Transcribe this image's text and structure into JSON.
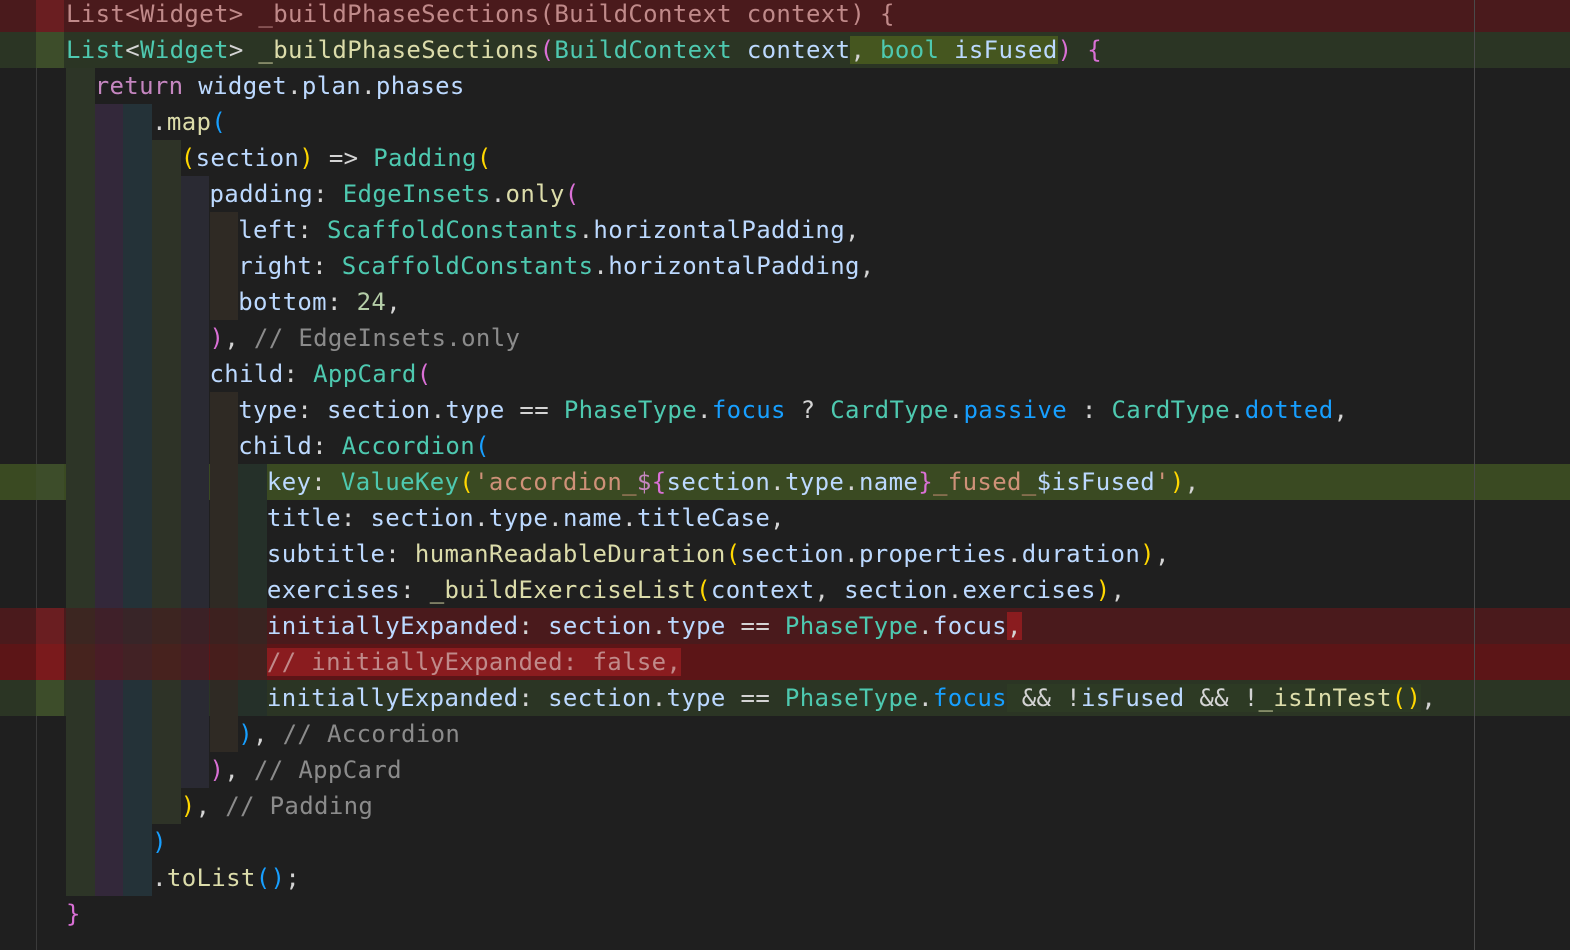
{
  "editor": {
    "language": "dart",
    "colors": {
      "background": "#1f1f1f",
      "added_line": "#2b3524",
      "removed_line": "#4a1a1c",
      "keyword": "#c586c0",
      "type": "#4ec9b0",
      "function": "#dcdcaa",
      "variable": "#bcd9ff",
      "string": "#ce9178",
      "number": "#b5cea8",
      "comment": "#8b8b8b"
    },
    "lines": [
      {
        "diff": "removed",
        "indent": 0,
        "tokens": [
          {
            "t": "List<Widget> _buildPhaseSections(BuildContext context) {",
            "c": "cmr"
          }
        ]
      },
      {
        "diff": "added",
        "indent": 0,
        "tokens": [
          {
            "t": "List",
            "c": "ty"
          },
          {
            "t": "<",
            "c": "pn"
          },
          {
            "t": "Widget",
            "c": "ty"
          },
          {
            "t": "> ",
            "c": "pn"
          },
          {
            "t": "_buildPhaseSections",
            "c": "fn"
          },
          {
            "t": "(",
            "c": "b2"
          },
          {
            "t": "BuildContext",
            "c": "ty"
          },
          {
            "t": " ",
            "c": "pn"
          },
          {
            "t": "context",
            "c": "vr"
          },
          {
            "t": ", bool isFused",
            "c": "vr",
            "hl": "add",
            "parts": [
              {
                "t": ", ",
                "c": "pn"
              },
              {
                "t": "bool",
                "c": "ty"
              },
              {
                "t": " ",
                "c": "pn"
              },
              {
                "t": "isFused",
                "c": "vr"
              }
            ]
          },
          {
            "t": ")",
            "c": "b2"
          },
          {
            "t": " ",
            "c": "pn"
          },
          {
            "t": "{",
            "c": "b2"
          }
        ]
      },
      {
        "diff": "none",
        "indent": 1,
        "tokens": [
          {
            "t": "return",
            "c": "kw"
          },
          {
            "t": " ",
            "c": "pn"
          },
          {
            "t": "widget",
            "c": "vr"
          },
          {
            "t": ".",
            "c": "pn"
          },
          {
            "t": "plan",
            "c": "vr"
          },
          {
            "t": ".",
            "c": "pn"
          },
          {
            "t": "phases",
            "c": "vr"
          }
        ]
      },
      {
        "diff": "none",
        "indent": 3,
        "tokens": [
          {
            "t": ".",
            "c": "pn"
          },
          {
            "t": "map",
            "c": "fn"
          },
          {
            "t": "(",
            "c": "b3"
          }
        ]
      },
      {
        "diff": "none",
        "indent": 4,
        "tokens": [
          {
            "t": "(",
            "c": "b1"
          },
          {
            "t": "section",
            "c": "vr"
          },
          {
            "t": ")",
            "c": "b1"
          },
          {
            "t": " => ",
            "c": "pn"
          },
          {
            "t": "Padding",
            "c": "ty"
          },
          {
            "t": "(",
            "c": "b1"
          }
        ]
      },
      {
        "diff": "none",
        "indent": 5,
        "tokens": [
          {
            "t": "padding",
            "c": "vr"
          },
          {
            "t": ": ",
            "c": "pn"
          },
          {
            "t": "EdgeInsets",
            "c": "ty"
          },
          {
            "t": ".",
            "c": "pn"
          },
          {
            "t": "only",
            "c": "fn"
          },
          {
            "t": "(",
            "c": "b2"
          }
        ]
      },
      {
        "diff": "none",
        "indent": 6,
        "tokens": [
          {
            "t": "left",
            "c": "vr"
          },
          {
            "t": ": ",
            "c": "pn"
          },
          {
            "t": "ScaffoldConstants",
            "c": "ty"
          },
          {
            "t": ".",
            "c": "pn"
          },
          {
            "t": "horizontalPadding",
            "c": "vr"
          },
          {
            "t": ",",
            "c": "pn"
          }
        ]
      },
      {
        "diff": "none",
        "indent": 6,
        "tokens": [
          {
            "t": "right",
            "c": "vr"
          },
          {
            "t": ": ",
            "c": "pn"
          },
          {
            "t": "ScaffoldConstants",
            "c": "ty"
          },
          {
            "t": ".",
            "c": "pn"
          },
          {
            "t": "horizontalPadding",
            "c": "vr"
          },
          {
            "t": ",",
            "c": "pn"
          }
        ]
      },
      {
        "diff": "none",
        "indent": 6,
        "tokens": [
          {
            "t": "bottom",
            "c": "vr"
          },
          {
            "t": ": ",
            "c": "pn"
          },
          {
            "t": "24",
            "c": "nm"
          },
          {
            "t": ",",
            "c": "pn"
          }
        ]
      },
      {
        "diff": "none",
        "indent": 5,
        "tokens": [
          {
            "t": ")",
            "c": "b2"
          },
          {
            "t": ", ",
            "c": "pn"
          },
          {
            "t": "// EdgeInsets.only",
            "c": "cm"
          }
        ]
      },
      {
        "diff": "none",
        "indent": 5,
        "tokens": [
          {
            "t": "child",
            "c": "vr"
          },
          {
            "t": ": ",
            "c": "pn"
          },
          {
            "t": "AppCard",
            "c": "ty"
          },
          {
            "t": "(",
            "c": "b2"
          }
        ]
      },
      {
        "diff": "none",
        "indent": 6,
        "tokens": [
          {
            "t": "type",
            "c": "vr"
          },
          {
            "t": ": ",
            "c": "pn"
          },
          {
            "t": "section",
            "c": "vr"
          },
          {
            "t": ".",
            "c": "pn"
          },
          {
            "t": "type",
            "c": "vr"
          },
          {
            "t": " == ",
            "c": "pn"
          },
          {
            "t": "PhaseType",
            "c": "ty"
          },
          {
            "t": ".",
            "c": "pn"
          },
          {
            "t": "focus",
            "c": "b3"
          },
          {
            "t": " ? ",
            "c": "pn"
          },
          {
            "t": "CardType",
            "c": "ty"
          },
          {
            "t": ".",
            "c": "pn"
          },
          {
            "t": "passive",
            "c": "b3"
          },
          {
            "t": " : ",
            "c": "pn"
          },
          {
            "t": "CardType",
            "c": "ty"
          },
          {
            "t": ".",
            "c": "pn"
          },
          {
            "t": "dotted",
            "c": "b3"
          },
          {
            "t": ",",
            "c": "pn"
          }
        ]
      },
      {
        "diff": "none",
        "indent": 6,
        "tokens": [
          {
            "t": "child",
            "c": "vr"
          },
          {
            "t": ": ",
            "c": "pn"
          },
          {
            "t": "Accordion",
            "c": "ty"
          },
          {
            "t": "(",
            "c": "b3"
          }
        ]
      },
      {
        "diff": "added-strong",
        "indent": 7,
        "tokens": [
          {
            "t": "key",
            "c": "vr"
          },
          {
            "t": ": ",
            "c": "pn"
          },
          {
            "t": "ValueKey",
            "c": "ty"
          },
          {
            "t": "(",
            "c": "b1"
          },
          {
            "t": "'accordion_",
            "c": "st"
          },
          {
            "t": "$",
            "c": "kw"
          },
          {
            "t": "{",
            "c": "b2"
          },
          {
            "t": "section",
            "c": "vr"
          },
          {
            "t": ".",
            "c": "pn"
          },
          {
            "t": "type",
            "c": "vr"
          },
          {
            "t": ".",
            "c": "pn"
          },
          {
            "t": "name",
            "c": "vr"
          },
          {
            "t": "}",
            "c": "b2"
          },
          {
            "t": "_fused_",
            "c": "st"
          },
          {
            "t": "$isFused",
            "c": "vr"
          },
          {
            "t": "'",
            "c": "st"
          },
          {
            "t": ")",
            "c": "b1"
          },
          {
            "t": ",",
            "c": "pn"
          }
        ]
      },
      {
        "diff": "none",
        "indent": 7,
        "tokens": [
          {
            "t": "title",
            "c": "vr"
          },
          {
            "t": ": ",
            "c": "pn"
          },
          {
            "t": "section",
            "c": "vr"
          },
          {
            "t": ".",
            "c": "pn"
          },
          {
            "t": "type",
            "c": "vr"
          },
          {
            "t": ".",
            "c": "pn"
          },
          {
            "t": "name",
            "c": "vr"
          },
          {
            "t": ".",
            "c": "pn"
          },
          {
            "t": "titleCase",
            "c": "vr"
          },
          {
            "t": ",",
            "c": "pn"
          }
        ]
      },
      {
        "diff": "none",
        "indent": 7,
        "tokens": [
          {
            "t": "subtitle",
            "c": "vr"
          },
          {
            "t": ": ",
            "c": "pn"
          },
          {
            "t": "humanReadableDuration",
            "c": "fn"
          },
          {
            "t": "(",
            "c": "b1"
          },
          {
            "t": "section",
            "c": "vr"
          },
          {
            "t": ".",
            "c": "pn"
          },
          {
            "t": "properties",
            "c": "vr"
          },
          {
            "t": ".",
            "c": "pn"
          },
          {
            "t": "duration",
            "c": "vr"
          },
          {
            "t": ")",
            "c": "b1"
          },
          {
            "t": ",",
            "c": "pn"
          }
        ]
      },
      {
        "diff": "none",
        "indent": 7,
        "tokens": [
          {
            "t": "exercises",
            "c": "vr"
          },
          {
            "t": ": ",
            "c": "pn"
          },
          {
            "t": "_buildExerciseList",
            "c": "fn"
          },
          {
            "t": "(",
            "c": "b1"
          },
          {
            "t": "context",
            "c": "vr"
          },
          {
            "t": ", ",
            "c": "pn"
          },
          {
            "t": "section",
            "c": "vr"
          },
          {
            "t": ".",
            "c": "pn"
          },
          {
            "t": "exercises",
            "c": "vr"
          },
          {
            "t": ")",
            "c": "b1"
          },
          {
            "t": ",",
            "c": "pn"
          }
        ]
      },
      {
        "diff": "removed",
        "indent": 7,
        "tokens": [
          {
            "t": "initiallyExpanded",
            "c": "vr"
          },
          {
            "t": ": ",
            "c": "pn"
          },
          {
            "t": "section",
            "c": "vr"
          },
          {
            "t": ".",
            "c": "pn"
          },
          {
            "t": "type",
            "c": "vr"
          },
          {
            "t": " == ",
            "c": "pn"
          },
          {
            "t": "PhaseType",
            "c": "ty"
          },
          {
            "t": ".",
            "c": "pn"
          },
          {
            "t": "focus",
            "c": "vr"
          },
          {
            "t": ",",
            "c": "pn",
            "hl": "del"
          }
        ]
      },
      {
        "diff": "removed-strong",
        "indent": 7,
        "tokens": [
          {
            "t": "// initiallyExpanded: false,",
            "c": "cmr",
            "hl": "del"
          }
        ]
      },
      {
        "diff": "added",
        "indent": 7,
        "tokens": [
          {
            "t": "initiallyExpanded",
            "c": "vr"
          },
          {
            "t": ": ",
            "c": "pn"
          },
          {
            "t": "section",
            "c": "vr"
          },
          {
            "t": ".",
            "c": "pn"
          },
          {
            "t": "type",
            "c": "vr"
          },
          {
            "t": " == ",
            "c": "pn"
          },
          {
            "t": "PhaseType",
            "c": "ty"
          },
          {
            "t": ".",
            "c": "pn"
          },
          {
            "t": "focus",
            "c": "b3"
          },
          {
            "t": " && !isFused && !_isInTest()",
            "c": "pn",
            "hl": "add2",
            "parts": [
              {
                "t": " && !",
                "c": "pn"
              },
              {
                "t": "isFused",
                "c": "vr"
              },
              {
                "t": " && !",
                "c": "pn"
              },
              {
                "t": "_isInTest",
                "c": "fn"
              },
              {
                "t": "()",
                "c": "b1"
              }
            ]
          },
          {
            "t": ",",
            "c": "pn"
          }
        ]
      },
      {
        "diff": "none",
        "indent": 6,
        "tokens": [
          {
            "t": ")",
            "c": "b3"
          },
          {
            "t": ", ",
            "c": "pn"
          },
          {
            "t": "// Accordion",
            "c": "cm"
          }
        ]
      },
      {
        "diff": "none",
        "indent": 5,
        "tokens": [
          {
            "t": ")",
            "c": "b2"
          },
          {
            "t": ", ",
            "c": "pn"
          },
          {
            "t": "// AppCard",
            "c": "cm"
          }
        ]
      },
      {
        "diff": "none",
        "indent": 4,
        "tokens": [
          {
            "t": ")",
            "c": "b1"
          },
          {
            "t": ", ",
            "c": "pn"
          },
          {
            "t": "// Padding",
            "c": "cm"
          }
        ]
      },
      {
        "diff": "none",
        "indent": 3,
        "tokens": [
          {
            "t": ")",
            "c": "b3"
          }
        ]
      },
      {
        "diff": "none",
        "indent": 3,
        "tokens": [
          {
            "t": ".",
            "c": "pn"
          },
          {
            "t": "toList",
            "c": "fn"
          },
          {
            "t": "()",
            "c": "b3"
          },
          {
            "t": ";",
            "c": "pn"
          }
        ]
      },
      {
        "diff": "none",
        "indent": 0,
        "tokens": [
          {
            "t": "}",
            "c": "b2"
          }
        ]
      }
    ]
  }
}
